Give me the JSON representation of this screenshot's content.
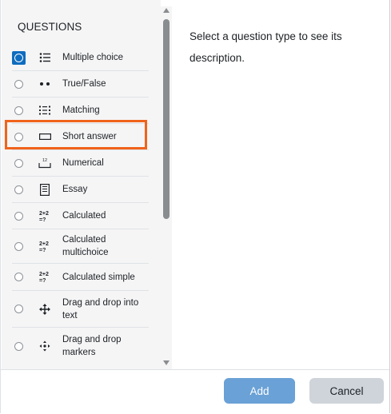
{
  "questions": {
    "heading": "QUESTIONS",
    "selected_index": 0,
    "highlighted_index": 3,
    "items": [
      {
        "label": "Multiple choice",
        "icon": "multiple-choice-icon"
      },
      {
        "label": "True/False",
        "icon": "true-false-icon"
      },
      {
        "label": "Matching",
        "icon": "matching-icon"
      },
      {
        "label": "Short answer",
        "icon": "short-answer-icon"
      },
      {
        "label": "Numerical",
        "icon": "numerical-icon"
      },
      {
        "label": "Essay",
        "icon": "essay-icon"
      },
      {
        "label": "Calculated",
        "icon": "calculated-icon"
      },
      {
        "label": "Calculated multichoice",
        "icon": "calculated-multichoice-icon"
      },
      {
        "label": "Calculated simple",
        "icon": "calculated-simple-icon"
      },
      {
        "label": "Drag and drop into text",
        "icon": "drag-drop-text-icon"
      },
      {
        "label": "Drag and drop markers",
        "icon": "drag-drop-markers-icon"
      }
    ],
    "icon_glyphs": {
      "calculated": "2+2\n=?",
      "numerical": "12"
    }
  },
  "description": {
    "text": "Select a question type to see its description."
  },
  "footer": {
    "add_label": "Add",
    "cancel_label": "Cancel"
  },
  "colors": {
    "primary": "#0f6cbf",
    "add_button": "#6aa1d6",
    "cancel_button": "#ced4da",
    "highlight_box": "#f0631b",
    "left_pane_bg": "#f5f5f6"
  }
}
